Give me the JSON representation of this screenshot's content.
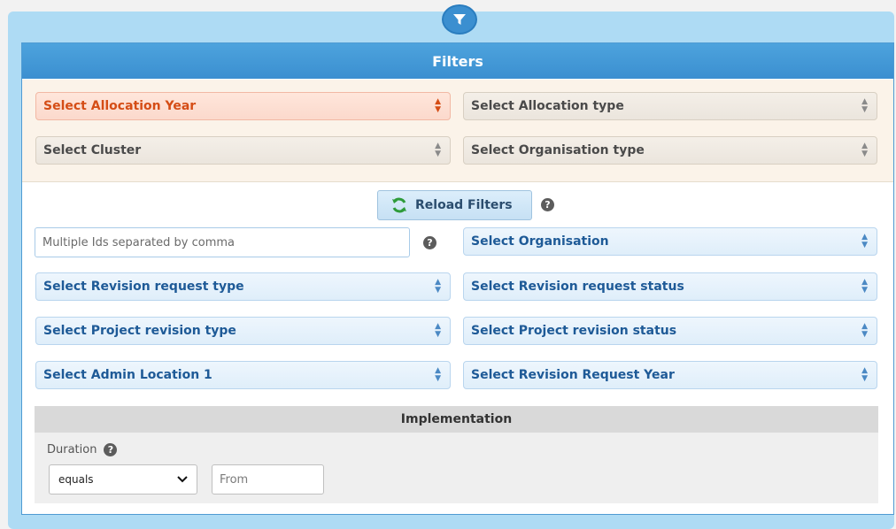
{
  "panel": {
    "title": "Filters"
  },
  "header_icons": {
    "badge": "funnel-icon"
  },
  "selects": {
    "allocation_year": "Select Allocation Year",
    "allocation_type": "Select Allocation type",
    "cluster": "Select Cluster",
    "organisation_type": "Select Organisation type",
    "organisation": "Select Organisation",
    "revision_request_type": "Select Revision request type",
    "revision_request_status": "Select Revision request status",
    "project_revision_type": "Select Project revision type",
    "project_revision_status": "Select Project revision status",
    "admin_location_1": "Select Admin Location 1",
    "revision_request_year": "Select Revision Request Year"
  },
  "reload": {
    "label": "Reload Filters",
    "icon": "refresh-icon"
  },
  "ids_input": {
    "placeholder": "Multiple Ids separated by comma",
    "value": ""
  },
  "implementation": {
    "title": "Implementation",
    "duration_label": "Duration",
    "operator_value": "equals",
    "from_placeholder": "From"
  },
  "colors": {
    "header_blue": "#3b8fd0",
    "outer_blue": "#aedbf4",
    "required_orange": "#d54d16",
    "select_blue_text": "#1e5a97"
  }
}
